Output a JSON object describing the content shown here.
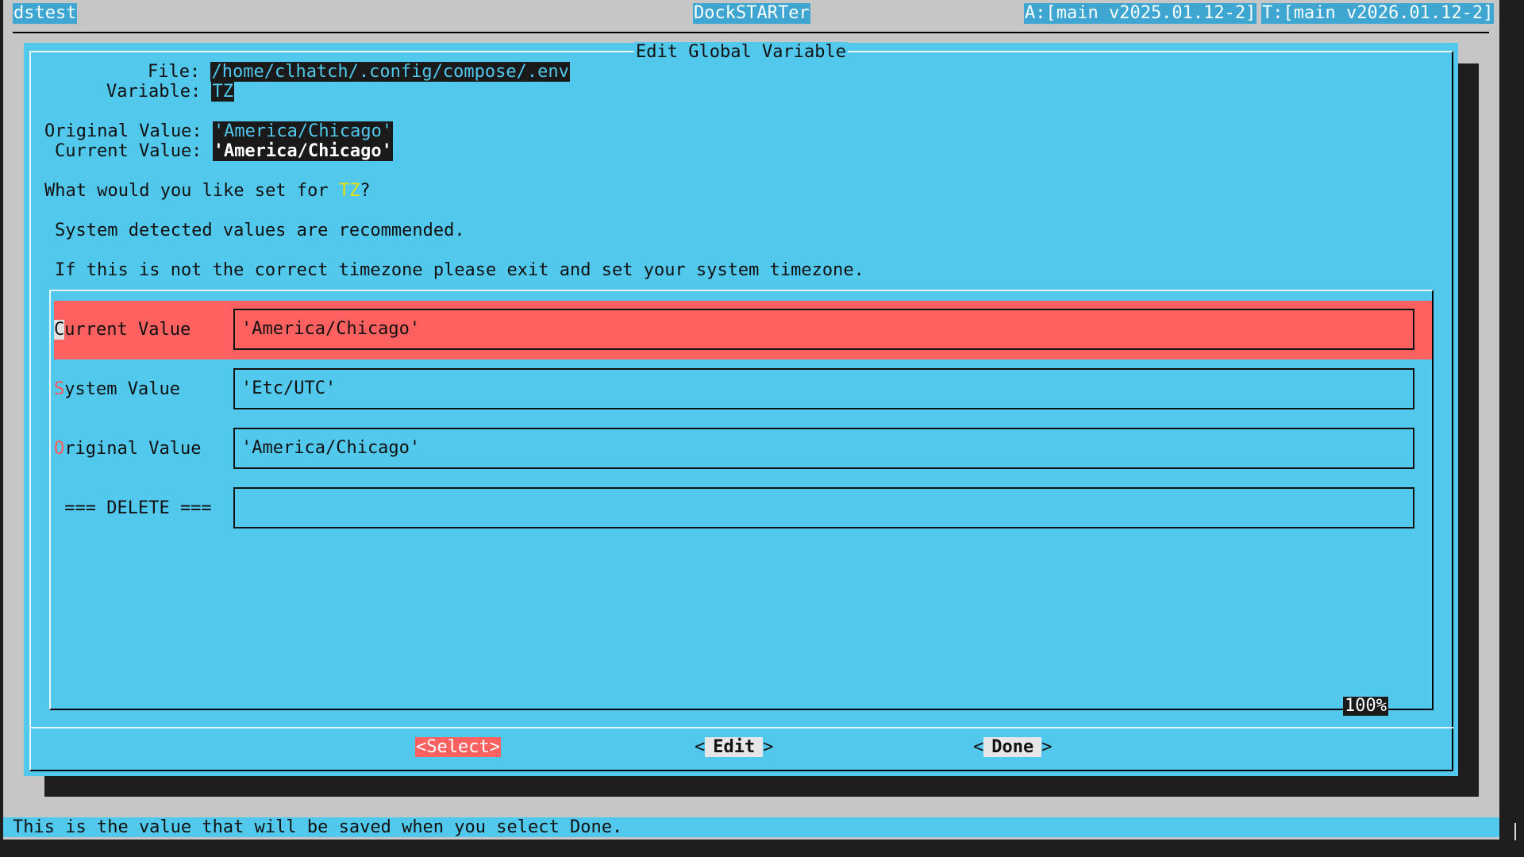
{
  "topbar": {
    "host": "dstest",
    "app": "DockSTARTer",
    "app_version": "A:[main v2025.01.12-2]",
    "template_version": "T:[main v2026.01.12-2]"
  },
  "dialog": {
    "title": "Edit Global Variable",
    "file_label": "File:",
    "file_value": "/home/clhatch/.config/compose/.env",
    "variable_label": "Variable:",
    "variable_value": "TZ",
    "original_label": "Original Value:",
    "original_value": "'America/Chicago'",
    "current_label": "Current Value:",
    "current_value": "'America/Chicago'",
    "question_prefix": "What would you like set for ",
    "question_var": "TZ",
    "question_suffix": "?",
    "note1": "System detected values are recommended.",
    "note2": "If this is not the correct timezone please exit and set your system timezone."
  },
  "menu": {
    "items": [
      {
        "hotkey": "C",
        "label_rest": "urrent Value",
        "value": "'America/Chicago'",
        "selected": true
      },
      {
        "hotkey": "S",
        "label_rest": "ystem Value",
        "value": "'Etc/UTC'",
        "selected": false
      },
      {
        "hotkey": "O",
        "label_rest": "riginal Value",
        "value": "'America/Chicago'",
        "selected": false
      },
      {
        "hotkey": "",
        "label_rest": " === DELETE ===",
        "value": "",
        "selected": false
      }
    ],
    "scroll_percent": "100%"
  },
  "buttons": {
    "select": "<Select>",
    "edit_left": "<",
    "edit": "Edit",
    "edit_right": ">",
    "done_left": "<",
    "done": "Done",
    "done_right": ">"
  },
  "status_bar": "This is the value that will be saved when you select Done.",
  "colors": {
    "dialog_bg": "#52c8ec",
    "selected_row": "#ff6060",
    "highlight_bg": "#1a1a1a",
    "hotkey": "#ff5a5a",
    "var_accent": "#e8e000"
  }
}
